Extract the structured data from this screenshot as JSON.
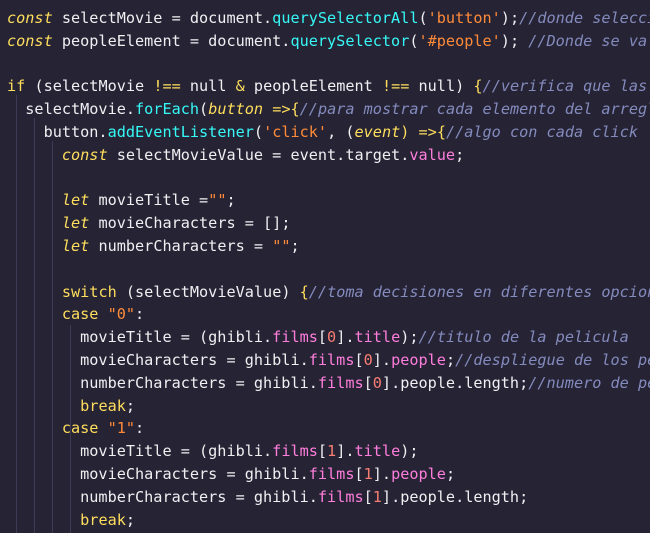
{
  "colors": {
    "background": "#262335",
    "keyword": "#fede5d",
    "storage_keyword": "#fede5d",
    "identifier": "#f0eff1",
    "function": "#36f9f6",
    "string": "#ff8b39",
    "comment": "#848bbd",
    "property": "#ff7edb",
    "number": "#f97e72",
    "punctuation": "#f0eff1",
    "brace": "#fede5d",
    "indent_guide": "#3e3a55"
  },
  "code": {
    "lines": [
      [
        {
          "t": "const",
          "c": "kw ital"
        },
        {
          "t": " selectMovie = document.",
          "c": "ident"
        },
        {
          "t": "querySelectorAll",
          "c": "fn"
        },
        {
          "t": "(",
          "c": "pn"
        },
        {
          "t": "'button'",
          "c": "str"
        },
        {
          "t": ");",
          "c": "pn"
        },
        {
          "t": "//donde seleccionamos",
          "c": "cm"
        }
      ],
      [
        {
          "t": "const",
          "c": "kw ital"
        },
        {
          "t": " peopleElement = document.",
          "c": "ident"
        },
        {
          "t": "querySelector",
          "c": "fn"
        },
        {
          "t": "(",
          "c": "pn"
        },
        {
          "t": "'#people'",
          "c": "str"
        },
        {
          "t": "); ",
          "c": "pn"
        },
        {
          "t": "//Donde se va a mostrar",
          "c": "cm"
        }
      ],
      [],
      [
        {
          "t": "if",
          "c": "kw"
        },
        {
          "t": " (selectMovie ",
          "c": "ident"
        },
        {
          "t": "!==",
          "c": "kw"
        },
        {
          "t": " null ",
          "c": "ident"
        },
        {
          "t": "&",
          "c": "kw"
        },
        {
          "t": " peopleElement ",
          "c": "ident"
        },
        {
          "t": "!==",
          "c": "kw"
        },
        {
          "t": " null) ",
          "c": "ident"
        },
        {
          "t": "{",
          "c": "br"
        },
        {
          "t": "//verifica que las variables",
          "c": "cm"
        }
      ],
      [
        {
          "t": "  selectMovie.",
          "c": "ident"
        },
        {
          "t": "forEach",
          "c": "fn"
        },
        {
          "t": "(",
          "c": "pn"
        },
        {
          "t": "button",
          "c": "kw ital"
        },
        {
          "t": " =>",
          "c": "kw"
        },
        {
          "t": "{",
          "c": "br"
        },
        {
          "t": "//para mostrar cada elemento del arreglo",
          "c": "cm"
        }
      ],
      [
        {
          "t": "    button.",
          "c": "ident"
        },
        {
          "t": "addEventListener",
          "c": "fn"
        },
        {
          "t": "(",
          "c": "pn"
        },
        {
          "t": "'click'",
          "c": "str"
        },
        {
          "t": ", (",
          "c": "pn"
        },
        {
          "t": "event",
          "c": "kw ital"
        },
        {
          "t": ") =>",
          "c": "kw"
        },
        {
          "t": "{",
          "c": "br"
        },
        {
          "t": "//algo con cada click",
          "c": "cm"
        }
      ],
      [
        {
          "t": "      ",
          "c": "ident"
        },
        {
          "t": "const",
          "c": "kw ital"
        },
        {
          "t": " selectMovieValue = event.target.",
          "c": "ident"
        },
        {
          "t": "value",
          "c": "prop"
        },
        {
          "t": ";",
          "c": "pn"
        }
      ],
      [],
      [
        {
          "t": "      ",
          "c": "ident"
        },
        {
          "t": "let",
          "c": "kw ital"
        },
        {
          "t": " movieTitle =",
          "c": "ident"
        },
        {
          "t": "\"\"",
          "c": "str"
        },
        {
          "t": ";",
          "c": "pn"
        }
      ],
      [
        {
          "t": "      ",
          "c": "ident"
        },
        {
          "t": "let",
          "c": "kw ital"
        },
        {
          "t": " movieCharacters = [];",
          "c": "ident"
        }
      ],
      [
        {
          "t": "      ",
          "c": "ident"
        },
        {
          "t": "let",
          "c": "kw ital"
        },
        {
          "t": " numberCharacters = ",
          "c": "ident"
        },
        {
          "t": "\"\"",
          "c": "str"
        },
        {
          "t": ";",
          "c": "pn"
        }
      ],
      [],
      [
        {
          "t": "      ",
          "c": "ident"
        },
        {
          "t": "switch",
          "c": "kw"
        },
        {
          "t": " (selectMovieValue) ",
          "c": "ident"
        },
        {
          "t": "{",
          "c": "br"
        },
        {
          "t": "//toma decisiones en diferentes opciones",
          "c": "cm"
        }
      ],
      [
        {
          "t": "      ",
          "c": "ident"
        },
        {
          "t": "case",
          "c": "kw"
        },
        {
          "t": " ",
          "c": "ident"
        },
        {
          "t": "\"0\"",
          "c": "str"
        },
        {
          "t": ":",
          "c": "pn"
        }
      ],
      [
        {
          "t": "        movieTitle = (ghibli.",
          "c": "ident"
        },
        {
          "t": "films",
          "c": "prop"
        },
        {
          "t": "[",
          "c": "pn"
        },
        {
          "t": "0",
          "c": "num"
        },
        {
          "t": "].",
          "c": "pn"
        },
        {
          "t": "title",
          "c": "prop"
        },
        {
          "t": ");",
          "c": "pn"
        },
        {
          "t": "//titulo de la pelicula",
          "c": "cm"
        }
      ],
      [
        {
          "t": "        movieCharacters = ghibli.",
          "c": "ident"
        },
        {
          "t": "films",
          "c": "prop"
        },
        {
          "t": "[",
          "c": "pn"
        },
        {
          "t": "0",
          "c": "num"
        },
        {
          "t": "].",
          "c": "pn"
        },
        {
          "t": "people",
          "c": "prop"
        },
        {
          "t": ";",
          "c": "pn"
        },
        {
          "t": "//despliegue de los personajes",
          "c": "cm"
        }
      ],
      [
        {
          "t": "        numberCharacters = ghibli.",
          "c": "ident"
        },
        {
          "t": "films",
          "c": "prop"
        },
        {
          "t": "[",
          "c": "pn"
        },
        {
          "t": "0",
          "c": "num"
        },
        {
          "t": "].people.length;",
          "c": "ident"
        },
        {
          "t": "//numero de personajes",
          "c": "cm"
        }
      ],
      [
        {
          "t": "        ",
          "c": "ident"
        },
        {
          "t": "break",
          "c": "kw"
        },
        {
          "t": ";",
          "c": "pn"
        }
      ],
      [
        {
          "t": "      ",
          "c": "ident"
        },
        {
          "t": "case",
          "c": "kw"
        },
        {
          "t": " ",
          "c": "ident"
        },
        {
          "t": "\"1\"",
          "c": "str"
        },
        {
          "t": ":",
          "c": "pn"
        }
      ],
      [
        {
          "t": "        movieTitle = (ghibli.",
          "c": "ident"
        },
        {
          "t": "films",
          "c": "prop"
        },
        {
          "t": "[",
          "c": "pn"
        },
        {
          "t": "1",
          "c": "num"
        },
        {
          "t": "].",
          "c": "pn"
        },
        {
          "t": "title",
          "c": "prop"
        },
        {
          "t": ");",
          "c": "pn"
        }
      ],
      [
        {
          "t": "        movieCharacters = ghibli.",
          "c": "ident"
        },
        {
          "t": "films",
          "c": "prop"
        },
        {
          "t": "[",
          "c": "pn"
        },
        {
          "t": "1",
          "c": "num"
        },
        {
          "t": "].",
          "c": "pn"
        },
        {
          "t": "people",
          "c": "prop"
        },
        {
          "t": ";",
          "c": "pn"
        }
      ],
      [
        {
          "t": "        numberCharacters = ghibli.",
          "c": "ident"
        },
        {
          "t": "films",
          "c": "prop"
        },
        {
          "t": "[",
          "c": "pn"
        },
        {
          "t": "1",
          "c": "num"
        },
        {
          "t": "].people.length;",
          "c": "ident"
        }
      ],
      [
        {
          "t": "        ",
          "c": "ident"
        },
        {
          "t": "break",
          "c": "kw"
        },
        {
          "t": ";",
          "c": "pn"
        }
      ]
    ]
  }
}
